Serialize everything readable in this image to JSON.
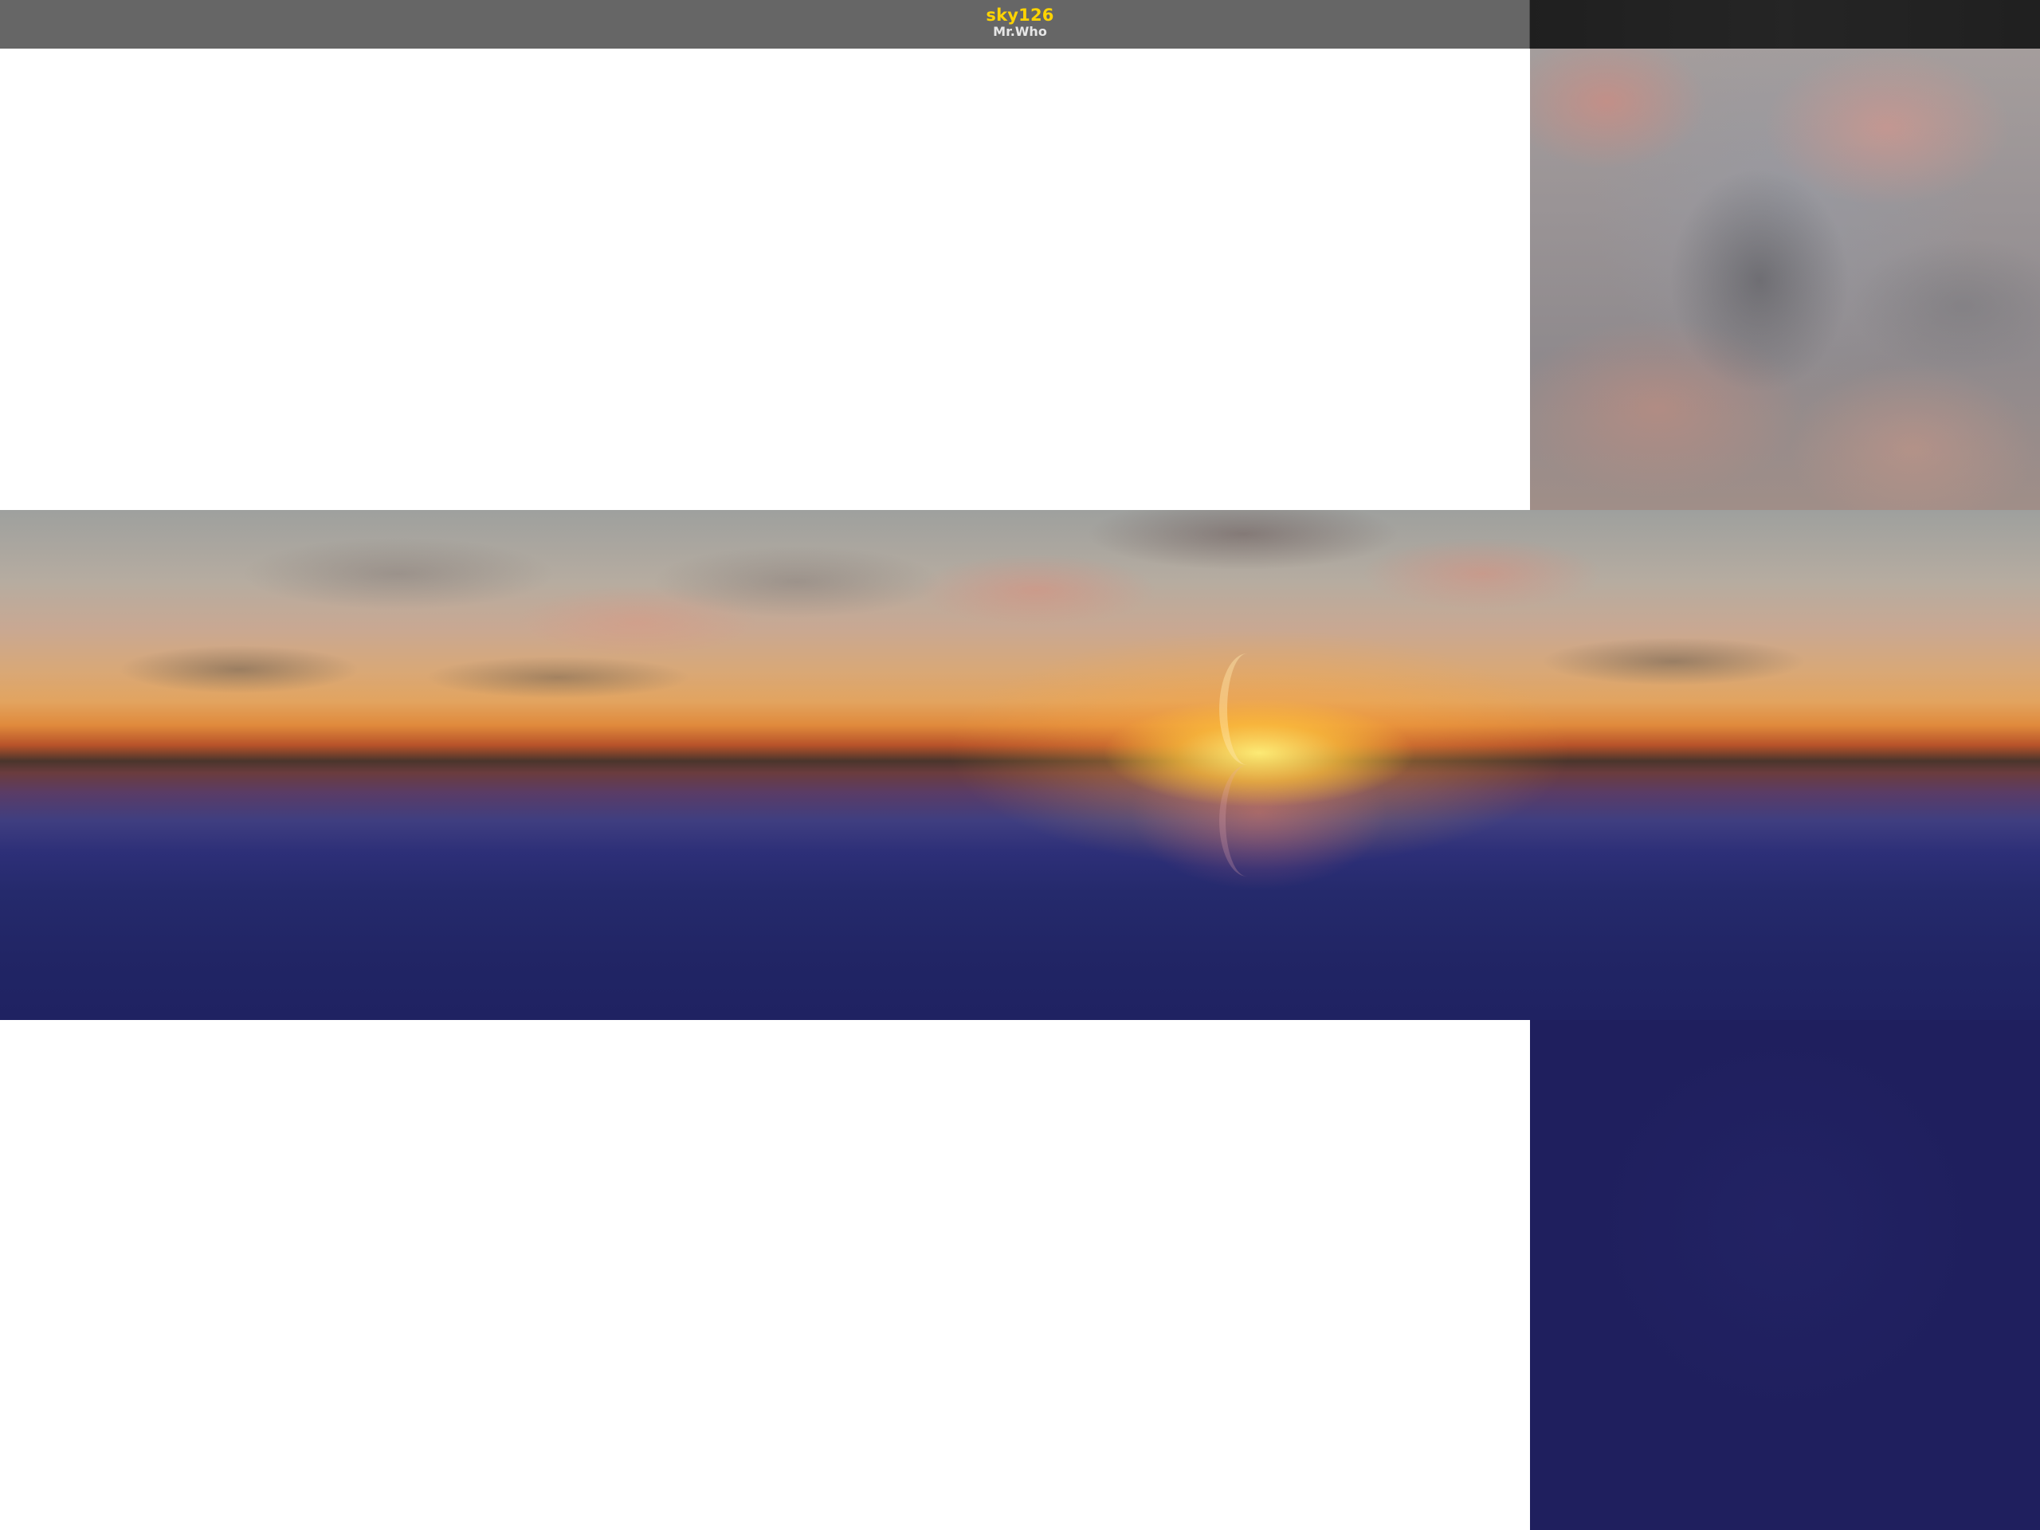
{
  "window": {
    "title": "sky126",
    "author": "Mr.Who"
  },
  "skybox": {
    "faces": [
      "up",
      "front",
      "down"
    ],
    "colors": {
      "title": "#ffd400",
      "author": "#e6e6e6",
      "titlebar": "#666666",
      "sea": "#1f1f5e",
      "sun": "#ffe27a"
    }
  }
}
